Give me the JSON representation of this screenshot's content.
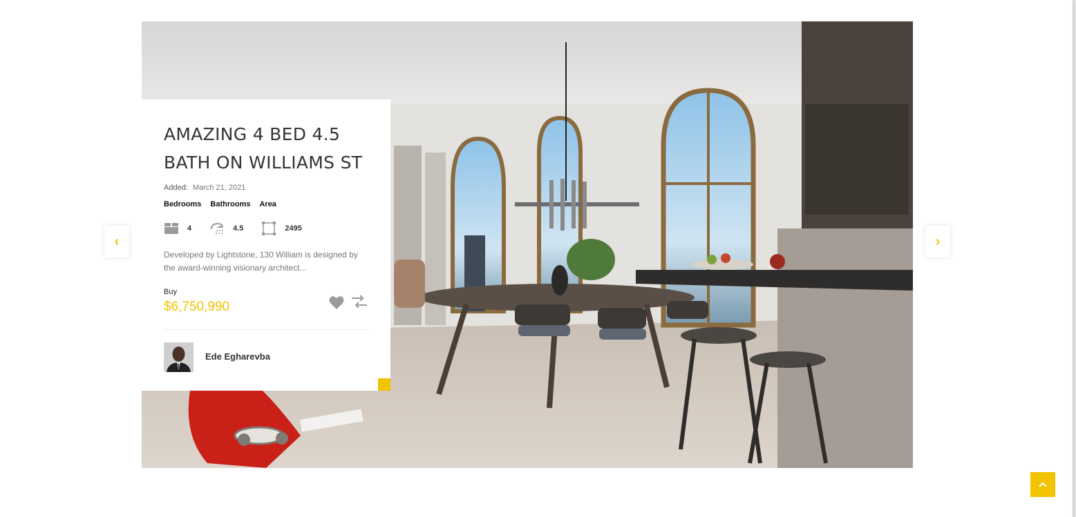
{
  "listing": {
    "title": "AMAZING 4 BED 4.5 BATH ON WILLIAMS ST",
    "added_label": "Added:",
    "added_date": "March 21, 2021",
    "features": {
      "labels": [
        "Bedrooms",
        "Bathrooms",
        "Area"
      ],
      "bedrooms": "4",
      "bathrooms": "4.5",
      "area": "2495"
    },
    "description": "Developed by Lightstone, 130 William is designed by the award-winning visionary architect...",
    "status": "Buy",
    "price": "$6,750,990",
    "agent_name": "Ede Egharevba"
  },
  "icons": {
    "bed": "bed-icon",
    "bath": "shower-icon",
    "area": "area-icon",
    "favorite": "heart-icon",
    "compare": "compare-arrows-icon",
    "prev": "chevron-left-icon",
    "next": "chevron-right-icon",
    "back_to_top": "chevron-up-icon"
  },
  "nav": {
    "prev_glyph": "‹",
    "next_glyph": "›"
  },
  "colors": {
    "accent": "#f2c300",
    "title": "#333333",
    "text_muted": "#777777"
  }
}
